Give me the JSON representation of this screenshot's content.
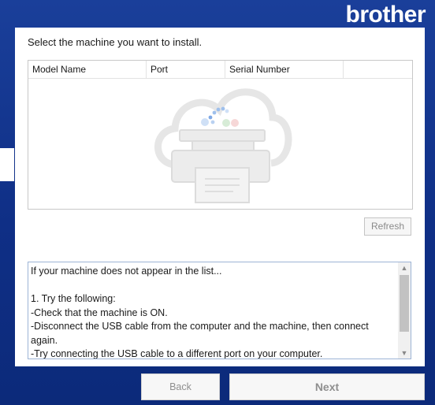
{
  "brand": {
    "logo_text": "brother",
    "color": "#ffffff"
  },
  "dialog": {
    "prompt": "Select the machine you want to install.",
    "machine_list": {
      "columns": [
        "Model Name",
        "Port",
        "Serial Number"
      ],
      "rows": []
    },
    "refresh_label": "Refresh",
    "info_lines": [
      "If your machine does not appear in the list...",
      "",
      "1. Try the following:",
      "-Check that the machine is ON.",
      "-Disconnect the USB cable from the computer and the machine, then connect again.",
      "-Try connecting the USB cable to a different port on your computer."
    ]
  },
  "nav": {
    "back_label": "Back",
    "next_label": "Next"
  },
  "colors": {
    "background": "#0f2f86",
    "panel": "#ffffff",
    "disabled_text": "#8f8f8f"
  }
}
